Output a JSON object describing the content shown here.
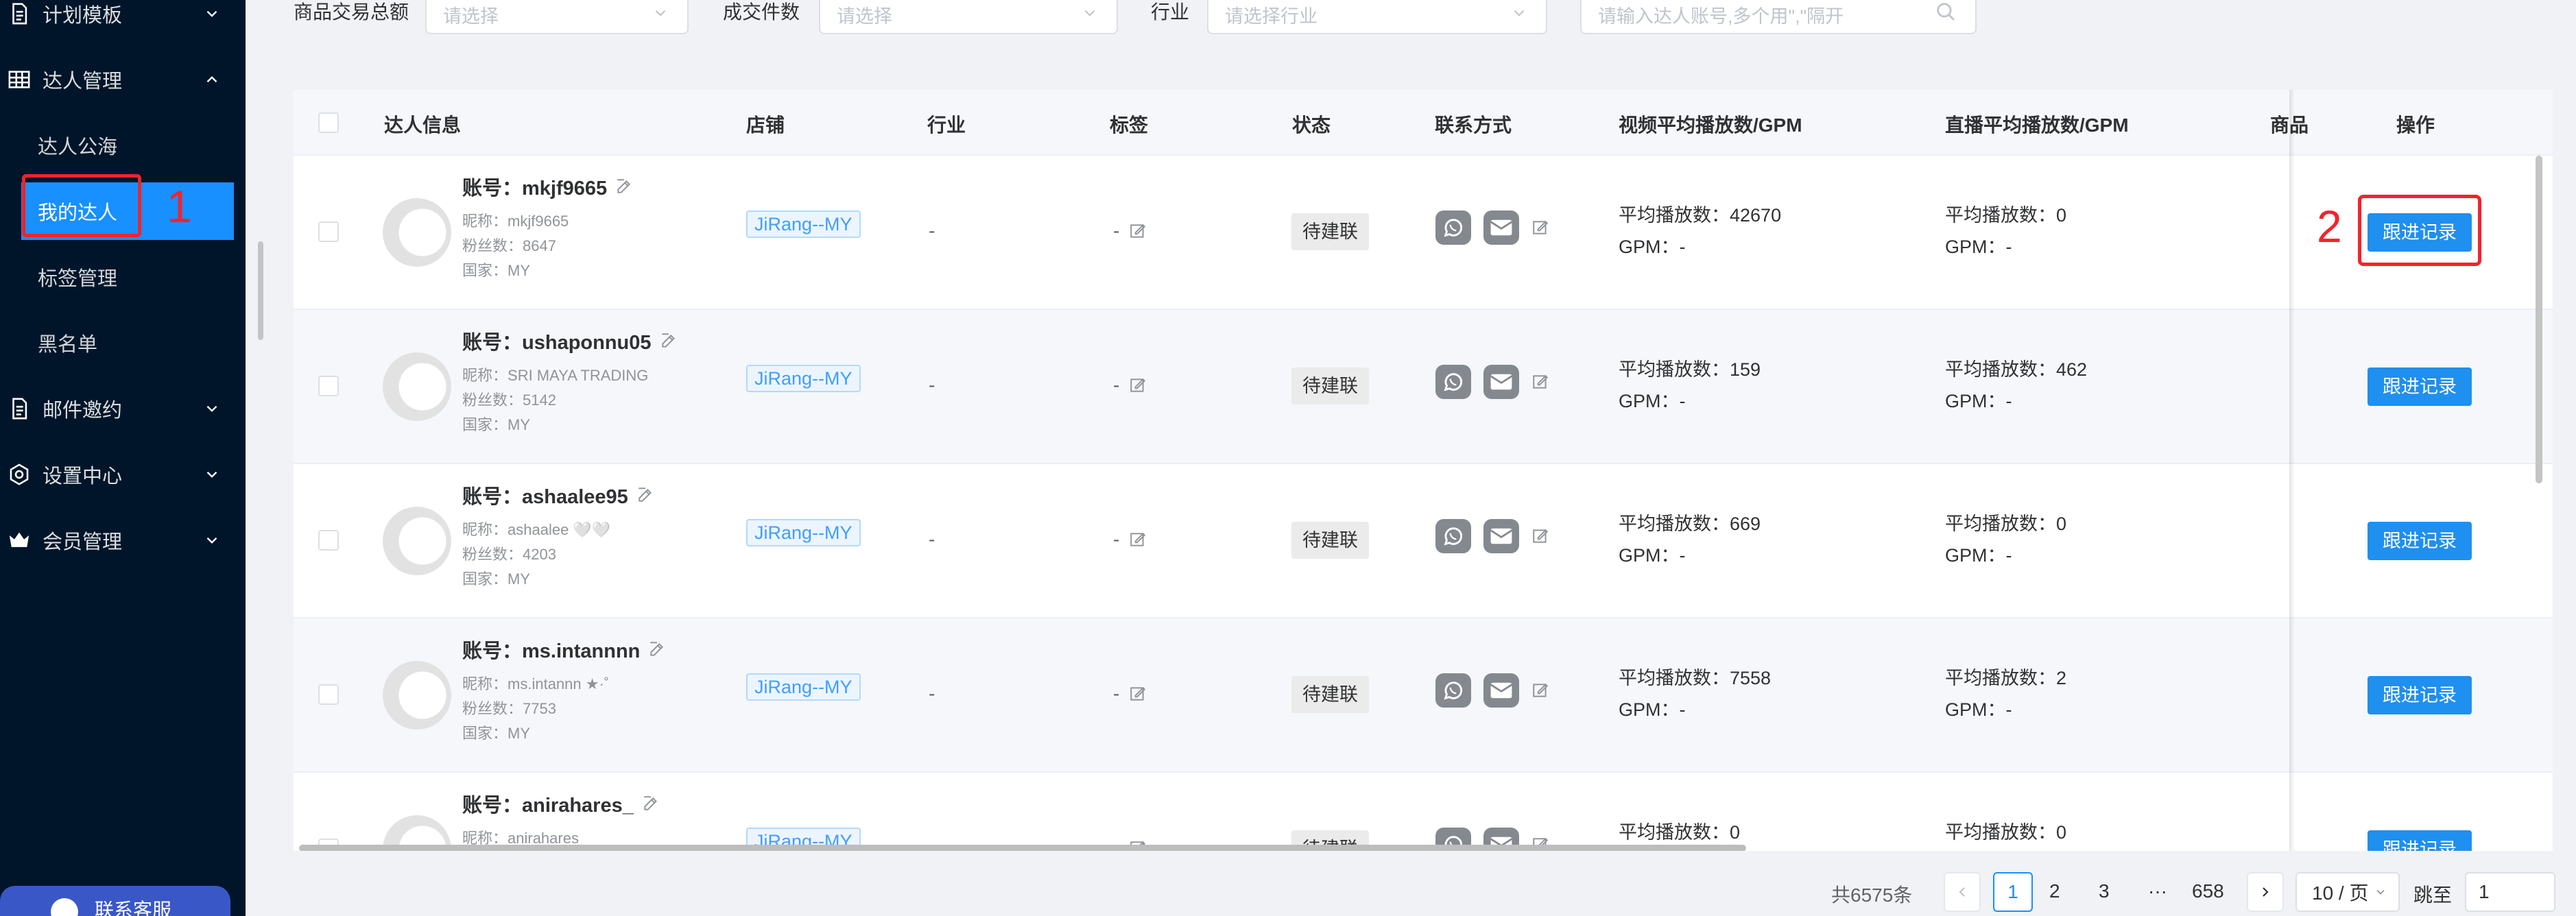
{
  "sidebar": {
    "items": [
      {
        "label": "计划模板",
        "icon": "document-icon",
        "expanded": false
      },
      {
        "label": "达人管理",
        "icon": "table-icon",
        "expanded": true,
        "children": [
          {
            "label": "达人公海"
          },
          {
            "label": "我的达人",
            "active": true
          },
          {
            "label": "标签管理"
          },
          {
            "label": "黑名单"
          }
        ]
      },
      {
        "label": "邮件邀约",
        "icon": "document-icon",
        "expanded": false
      },
      {
        "label": "设置中心",
        "icon": "settings-icon",
        "expanded": false
      },
      {
        "label": "会员管理",
        "icon": "crown-icon",
        "expanded": false
      }
    ],
    "contact_label": "联系客服"
  },
  "annotations": {
    "one": "1",
    "two": "2"
  },
  "filters": {
    "gmv_label": "商品交易总额",
    "gmv_placeholder": "请选择",
    "orders_label": "成交件数",
    "orders_placeholder": "请选择",
    "industry_label": "行业",
    "industry_placeholder": "请选择行业",
    "search_placeholder": "请输入达人账号,多个用\",\"隔开"
  },
  "table": {
    "headers": {
      "info": "达人信息",
      "shop": "店铺",
      "industry": "行业",
      "tags": "标签",
      "status": "状态",
      "contact": "联系方式",
      "video": "视频平均播放数/GPM",
      "live": "直播平均播放数/GPM",
      "product": "商品",
      "action": "操作"
    },
    "labels": {
      "account": "账号：",
      "nickname": "昵称：",
      "fans": "粉丝数：",
      "country": "国家：",
      "avg_play": "平均播放数：",
      "gpm": "GPM：",
      "dash": "-",
      "follow_btn": "跟进记录"
    },
    "rows": [
      {
        "account": "mkjf9665",
        "nickname": "mkjf9665",
        "fans": "8647",
        "country": "MY",
        "shop": "JiRang--MY",
        "industry": "-",
        "tag": "-",
        "status": "待建联",
        "video_avg": "42670",
        "video_gpm": "-",
        "live_avg": "0",
        "live_gpm": "-"
      },
      {
        "account": "ushaponnu05",
        "nickname": "SRI MAYA TRADING",
        "fans": "5142",
        "country": "MY",
        "shop": "JiRang--MY",
        "industry": "-",
        "tag": "-",
        "status": "待建联",
        "video_avg": "159",
        "video_gpm": "-",
        "live_avg": "462",
        "live_gpm": "-"
      },
      {
        "account": "ashaalee95",
        "nickname": "ashaalee 🤍🤍",
        "fans": "4203",
        "country": "MY",
        "shop": "JiRang--MY",
        "industry": "-",
        "tag": "-",
        "status": "待建联",
        "video_avg": "669",
        "video_gpm": "-",
        "live_avg": "0",
        "live_gpm": "-"
      },
      {
        "account": "ms.intannnn",
        "nickname": "ms.intannn ★·˚",
        "fans": "7753",
        "country": "MY",
        "shop": "JiRang--MY",
        "industry": "-",
        "tag": "-",
        "status": "待建联",
        "video_avg": "7558",
        "video_gpm": "-",
        "live_avg": "2",
        "live_gpm": "-"
      },
      {
        "account": "anirahares_",
        "nickname": "anirahares_",
        "fans": "",
        "country": "",
        "shop": "JiRang--MY",
        "industry": "-",
        "tag": "-",
        "status": "待建联",
        "video_avg": "0",
        "video_gpm": "",
        "live_avg": "0",
        "live_gpm": ""
      }
    ]
  },
  "pagination": {
    "total": "共6575条",
    "pages": [
      "1",
      "2",
      "3",
      "···",
      "658"
    ],
    "current": "1",
    "page_size": "10 / 页",
    "jump_label": "跳至",
    "jump_value": "1"
  },
  "colors": {
    "sidebar_bg": "#001529",
    "primary": "#1890ff",
    "annotation": "#f5222d"
  }
}
